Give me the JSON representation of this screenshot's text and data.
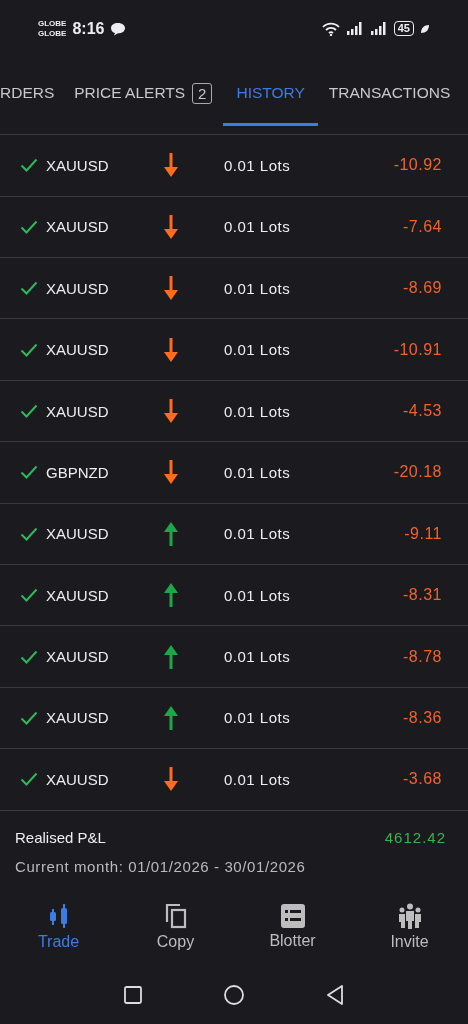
{
  "status_bar": {
    "carrier_1": "GLOBE",
    "carrier_2": "GLOBE",
    "time": "8:16",
    "battery": "45"
  },
  "tabs": [
    {
      "label": "RDERS",
      "selected": false
    },
    {
      "label": "PRICE ALERTS",
      "badge": "2",
      "selected": false
    },
    {
      "label": "HISTORY",
      "selected": true
    },
    {
      "label": "TRANSACTIONS",
      "selected": false
    }
  ],
  "trades": [
    {
      "symbol": "XAUUSD",
      "kind": "down",
      "volume": "0.01 Lots",
      "pnl": "-10.92"
    },
    {
      "symbol": "XAUUSD",
      "kind": "down",
      "volume": "0.01 Lots",
      "pnl": "-7.64"
    },
    {
      "symbol": "XAUUSD",
      "kind": "down",
      "volume": "0.01 Lots",
      "pnl": "-8.69"
    },
    {
      "symbol": "XAUUSD",
      "kind": "down",
      "volume": "0.01 Lots",
      "pnl": "-10.91"
    },
    {
      "symbol": "XAUUSD",
      "kind": "down",
      "volume": "0.01 Lots",
      "pnl": "-4.53"
    },
    {
      "symbol": "GBPNZD",
      "kind": "down",
      "volume": "0.01 Lots",
      "pnl": "-20.18"
    },
    {
      "symbol": "XAUUSD",
      "kind": "up",
      "volume": "0.01 Lots",
      "pnl": "-9.11"
    },
    {
      "symbol": "XAUUSD",
      "kind": "up",
      "volume": "0.01 Lots",
      "pnl": "-8.31"
    },
    {
      "symbol": "XAUUSD",
      "kind": "up",
      "volume": "0.01 Lots",
      "pnl": "-8.78"
    },
    {
      "symbol": "XAUUSD",
      "kind": "up",
      "volume": "0.01 Lots",
      "pnl": "-8.36"
    },
    {
      "symbol": "XAUUSD",
      "kind": "down",
      "volume": "0.01 Lots",
      "pnl": "-3.68"
    }
  ],
  "summary": {
    "label": "Realised P&L",
    "value": "4612.42",
    "period": "Current month: 01/01/2026 - 30/01/2026"
  },
  "bottom_nav": [
    {
      "label": "Trade",
      "selected": true
    },
    {
      "label": "Copy",
      "selected": false
    },
    {
      "label": "Blotter",
      "selected": false
    },
    {
      "label": "Invite",
      "selected": false
    }
  ]
}
